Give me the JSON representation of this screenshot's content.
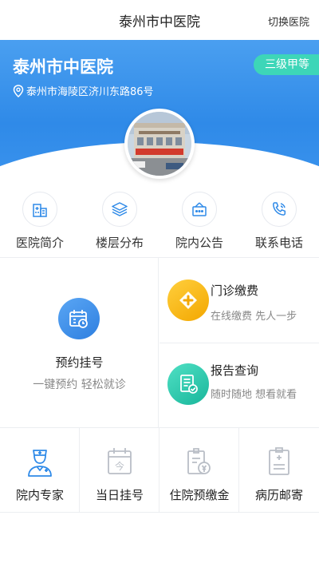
{
  "header": {
    "title": "泰州市中医院",
    "switch_label": "切换医院"
  },
  "hospital": {
    "name": "泰州市中医院",
    "grade": "三级甲等",
    "address": "泰州市海陵区济川东路86号"
  },
  "quick_links": [
    {
      "label": "医院简介",
      "icon": "hospital-building-icon"
    },
    {
      "label": "楼层分布",
      "icon": "layers-icon"
    },
    {
      "label": "院内公告",
      "icon": "notice-board-icon"
    },
    {
      "label": "联系电话",
      "icon": "phone-icon"
    }
  ],
  "main": {
    "appointment": {
      "title": "预约挂号",
      "subtitle": "一键预约 轻松就诊"
    },
    "payment": {
      "title": "门诊缴费",
      "subtitle": "在线缴费 先人一步"
    },
    "report": {
      "title": "报告查询",
      "subtitle": "随时随地 想看就看"
    }
  },
  "bottom_links": [
    {
      "label": "院内专家",
      "icon": "doctor-icon"
    },
    {
      "label": "当日挂号",
      "icon": "calendar-today-icon"
    },
    {
      "label": "住院预缴金",
      "icon": "deposit-icon"
    },
    {
      "label": "病历邮寄",
      "icon": "medical-record-icon"
    }
  ],
  "colors": {
    "brand_blue": "#2f8ae8",
    "badge_green": "#3dd6b8",
    "payment_orange": "#f5b400",
    "report_teal": "#23c3a7"
  }
}
